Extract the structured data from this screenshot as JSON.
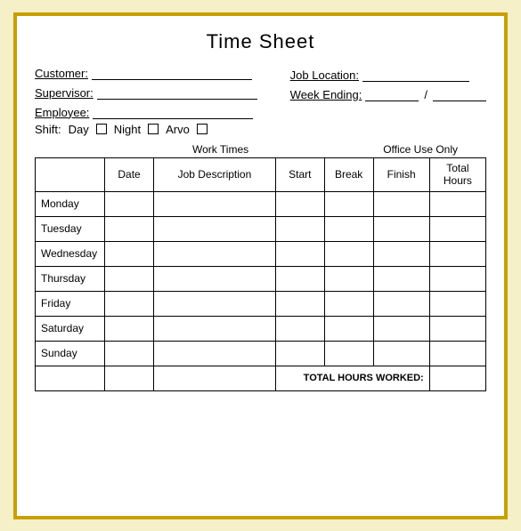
{
  "title": "Time Sheet",
  "fields": {
    "customer_label": "Customer:",
    "supervisor_label": "Supervisor:",
    "employee_label": "Employee:",
    "job_location_label": "Job Location:",
    "week_ending_label": "Week Ending:"
  },
  "shift": {
    "label": "Shift:",
    "options": [
      "Day",
      "Night",
      "Arvo"
    ]
  },
  "table": {
    "work_times_label": "Work Times",
    "office_use_label": "Office Use Only",
    "headers": [
      "",
      "Date",
      "Job Description",
      "Start",
      "Break",
      "Finish",
      "Total\nHours"
    ],
    "days": [
      "Monday",
      "Tuesday",
      "Wednesday",
      "Thursday",
      "Friday",
      "Saturday",
      "Sunday"
    ],
    "total_label": "TOTAL HOURS WORKED:"
  }
}
